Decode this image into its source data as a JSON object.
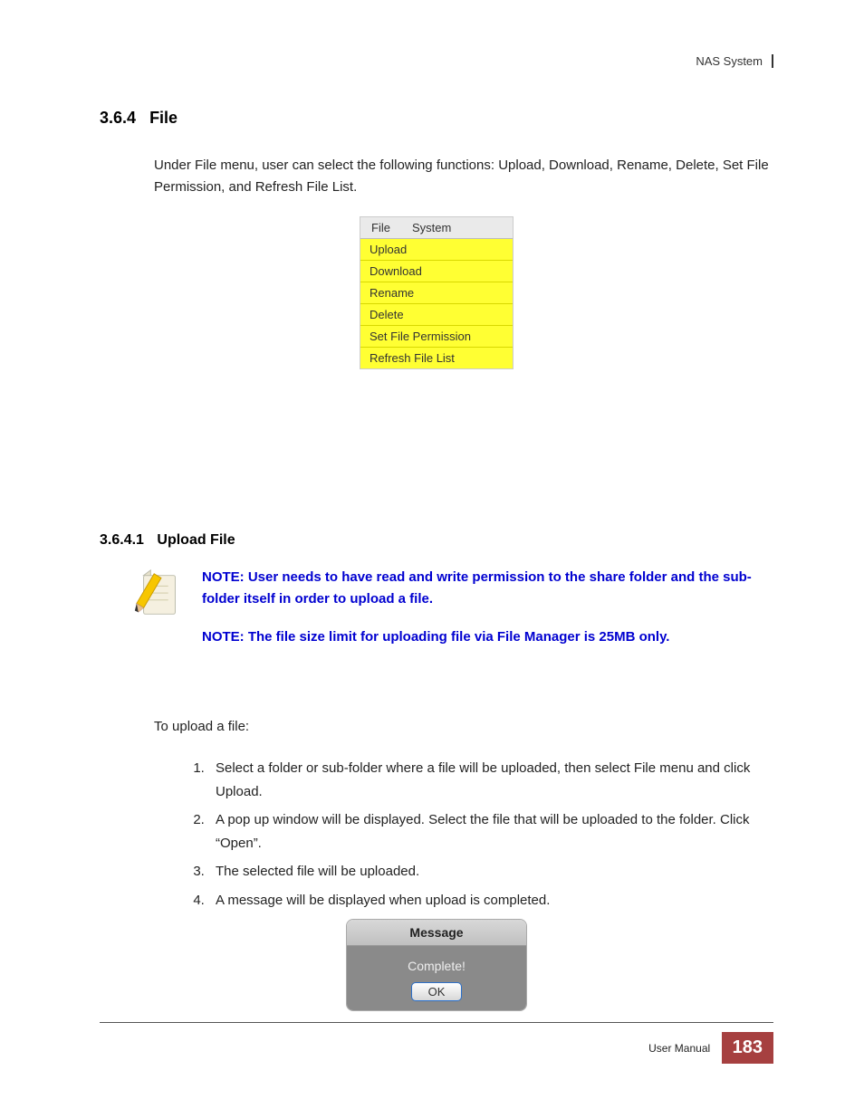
{
  "header": {
    "right": "NAS System"
  },
  "section": {
    "number": "3.6.4",
    "title": "File",
    "intro": "Under File menu, user can select the following functions: Upload, Download, Rename, Delete, Set File Permission, and Refresh File List."
  },
  "menu": {
    "bar": [
      "File",
      "System"
    ],
    "items": [
      "Upload",
      "Download",
      "Rename",
      "Delete",
      "Set File Permission",
      "Refresh File List"
    ]
  },
  "subsection": {
    "number": "3.6.4.1",
    "title": "Upload File"
  },
  "notes": [
    "NOTE: User needs to have read and write permission to the share folder and the sub-folder itself in order to upload a file.",
    "NOTE: The file size limit for uploading file via File Manager is 25MB only."
  ],
  "steps_intro": "To upload a file:",
  "steps": [
    "Select a folder or sub-folder where a file will be uploaded, then select File menu and click Upload.",
    "A pop up window will be displayed. Select the file that will be uploaded to the folder. Click “Open”.",
    "The selected file will be uploaded.",
    "A message will be displayed when upload is completed."
  ],
  "dialog": {
    "title": "Message",
    "body": "Complete!",
    "button": "OK"
  },
  "footer": {
    "label": "User Manual",
    "page": "183"
  }
}
